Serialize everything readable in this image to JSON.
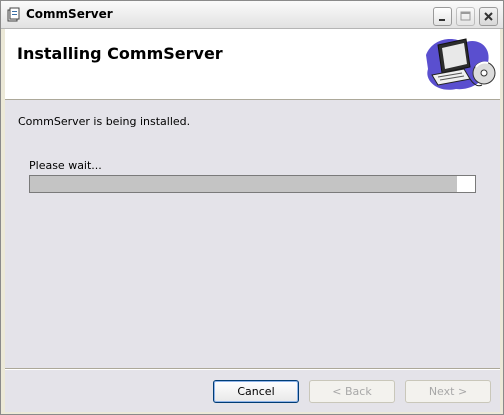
{
  "window": {
    "title": "CommServer"
  },
  "header": {
    "title": "Installing CommServer"
  },
  "body": {
    "status": "CommServer is being installed.",
    "wait_label": "Please wait...",
    "progress_fraction": 0.96
  },
  "footer": {
    "cancel_label": "Cancel",
    "back_label": "< Back",
    "next_label": "Next >"
  },
  "icons": {
    "app": "installer-icon",
    "header": "computer-with-disc-icon",
    "minimize": "minimize-icon",
    "maximize": "maximize-icon",
    "close": "close-icon"
  },
  "colors": {
    "progress_fill": "#c4c4c4",
    "focus_border": "#003c74"
  }
}
